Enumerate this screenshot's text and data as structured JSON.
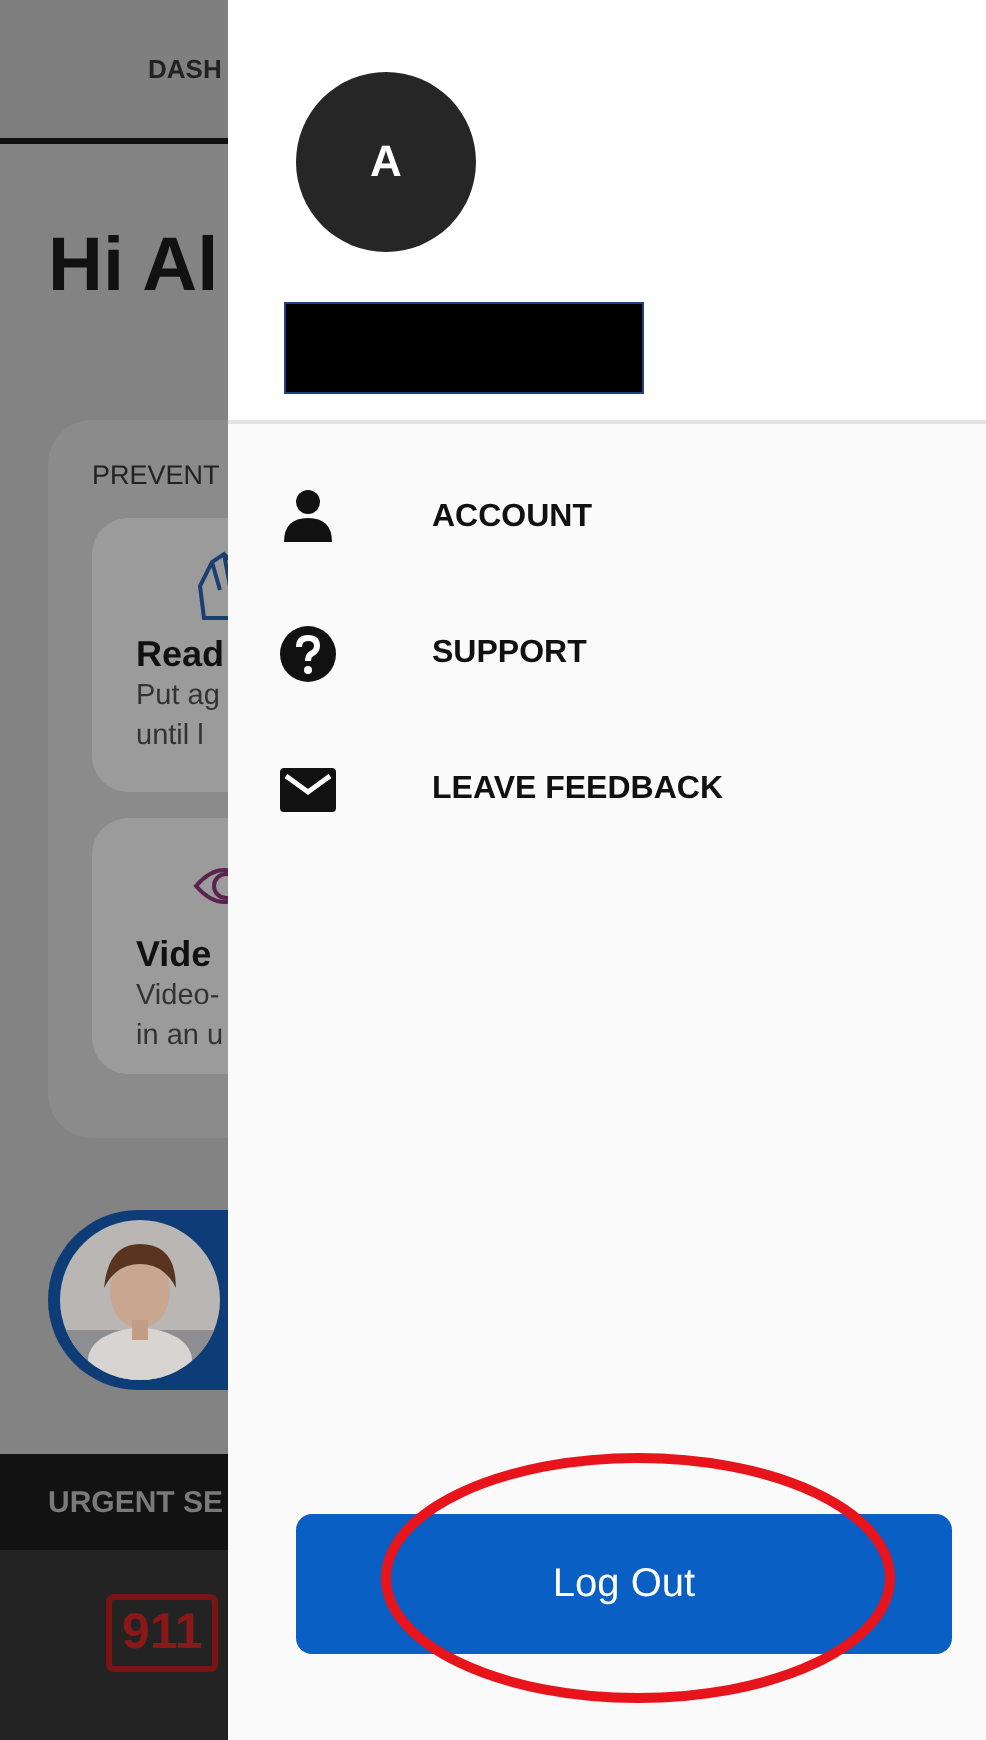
{
  "background_screen": {
    "tab": "DASH",
    "greeting": "Hi Al",
    "section_title": "PREVENT",
    "cards": [
      {
        "kind": "hand",
        "title": "Read",
        "lines": [
          "Put ag",
          "until l"
        ]
      },
      {
        "kind": "eye",
        "title": "Vide",
        "lines": [
          "Video-",
          "in an u"
        ]
      }
    ],
    "urgent_header": "URGENT SE",
    "emergency_badge": "911"
  },
  "drawer": {
    "avatar_initial": "A",
    "menu": [
      {
        "kind": "person",
        "label": "ACCOUNT"
      },
      {
        "kind": "help",
        "label": "SUPPORT"
      },
      {
        "kind": "mail",
        "label": "LEAVE FEEDBACK"
      }
    ],
    "logout_button": "Log Out"
  }
}
